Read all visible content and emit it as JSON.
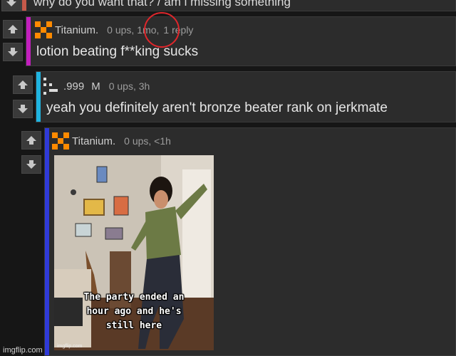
{
  "top_partial": {
    "text": "why do you want that? / am i missing something"
  },
  "comment1": {
    "author": "Titanium.",
    "ups": "0 ups,",
    "age": "1mo,",
    "replies": "1 reply",
    "body": "lotion beating f**king sucks",
    "bar_color": "#c21fbd"
  },
  "comment2": {
    "author": ".999",
    "badge": "M",
    "meta": "0 ups, 3h",
    "body": "yeah you definitely aren't bronze beater rank on jerkmate",
    "bar_color": "#1fb4e0"
  },
  "comment3": {
    "author": "Titanium.",
    "meta": "0 ups, <1h",
    "bar_color": "#2f3ad8",
    "image": {
      "caption_line1": "The party ended an",
      "caption_line2": "hour ago and he's",
      "caption_line3": "still here",
      "small_text": "imgflip.com"
    }
  },
  "watermark": "imgflip.com",
  "colors": {
    "annotation": "#e0262b",
    "avatar_orange": "#ff8a00"
  }
}
